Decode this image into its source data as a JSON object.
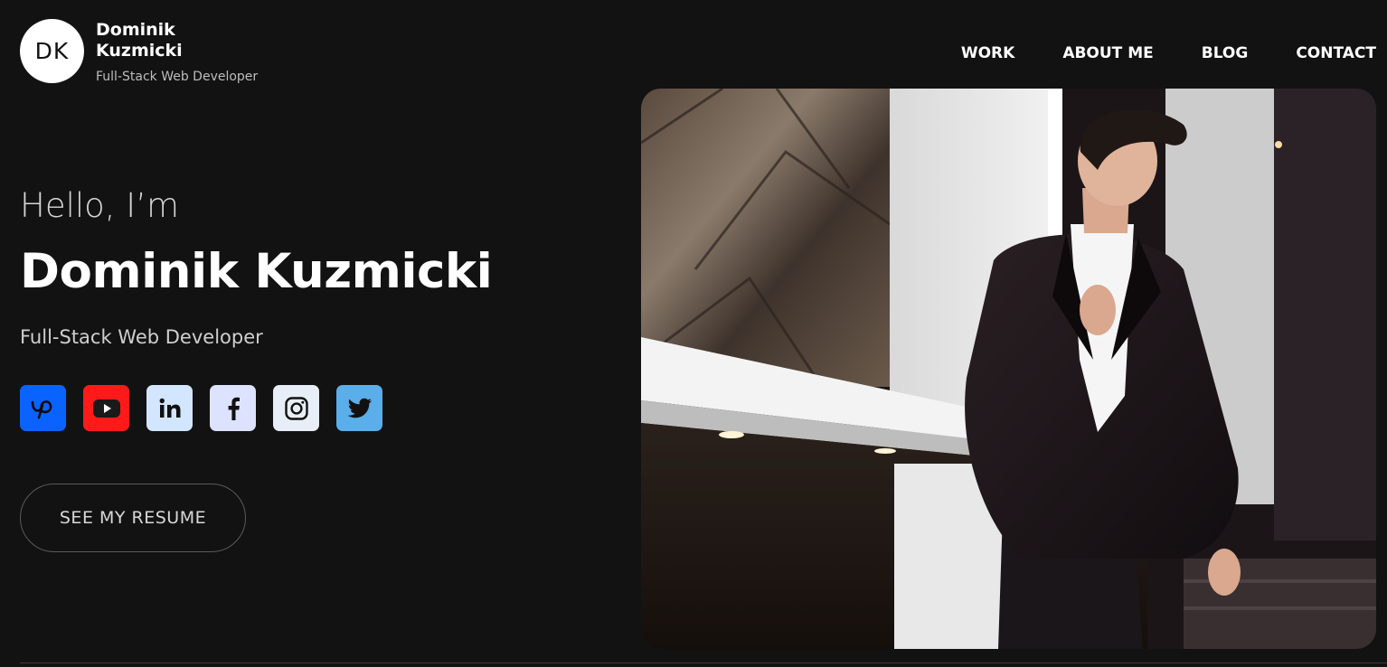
{
  "logo": {
    "initials": "DK"
  },
  "brand": {
    "name": "Dominik Kuzmicki",
    "role": "Full-Stack Web Developer"
  },
  "nav": {
    "items": [
      {
        "label": "WORK"
      },
      {
        "label": "ABOUT ME"
      },
      {
        "label": "BLOG"
      },
      {
        "label": "CONTACT"
      }
    ]
  },
  "hero": {
    "greeting": "Hello, I’m",
    "name": "Dominik Kuzmicki",
    "role": "Full-Stack Web Developer",
    "resume_label": "SEE MY RESUME"
  },
  "socials": [
    {
      "name": "upwork-icon",
      "color": "#0a63ff"
    },
    {
      "name": "youtube-icon",
      "color": "#ff1a1a"
    },
    {
      "name": "linkedin-icon",
      "color": "#d2e6ff"
    },
    {
      "name": "facebook-icon",
      "color": "#dde3ff"
    },
    {
      "name": "instagram-icon",
      "color": "#e8eef7"
    },
    {
      "name": "twitter-icon",
      "color": "#5aaee9"
    }
  ],
  "colors": {
    "background": "#121212",
    "text": "#ffffff",
    "muted": "#bdbdbd"
  }
}
